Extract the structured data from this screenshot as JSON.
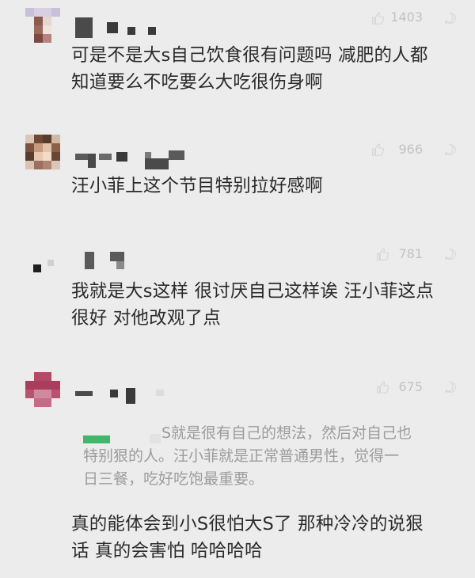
{
  "comments": [
    {
      "likes": "1403",
      "text_lines": [
        "可是不是大s自己饮食很有问题吗 减肥的人都",
        "知道要么不吃要么大吃很伤身啊"
      ]
    },
    {
      "likes": "966",
      "text_lines": [
        "汪小菲上这个节目特别拉好感啊"
      ]
    },
    {
      "likes": "781",
      "text_lines": [
        "我就是大s这样 很讨厌自己这样诶 汪小菲这点",
        "很好 对他改观了点"
      ]
    },
    {
      "likes": "675",
      "quote_lines": [
        "S就是很有自己的想法，然后对自己也",
        "特别狠的人。汪小菲就是正常普通男性，觉得一",
        "日三餐，吃好吃饱最重要。"
      ],
      "text_lines": [
        "真的能体会到小S很怕大S了 那种冷冷的说狠",
        "话 真的会害怕 哈哈哈哈"
      ]
    }
  ],
  "colors": {
    "background": "#ececec",
    "text": "#2a2a2a",
    "quote_text": "#9c9c9c",
    "like_count": "#c2c2c2",
    "quote_user_mark": "#3fb86a"
  },
  "icons": [
    "avatar-image",
    "thumb-up-icon",
    "reply-icon"
  ]
}
